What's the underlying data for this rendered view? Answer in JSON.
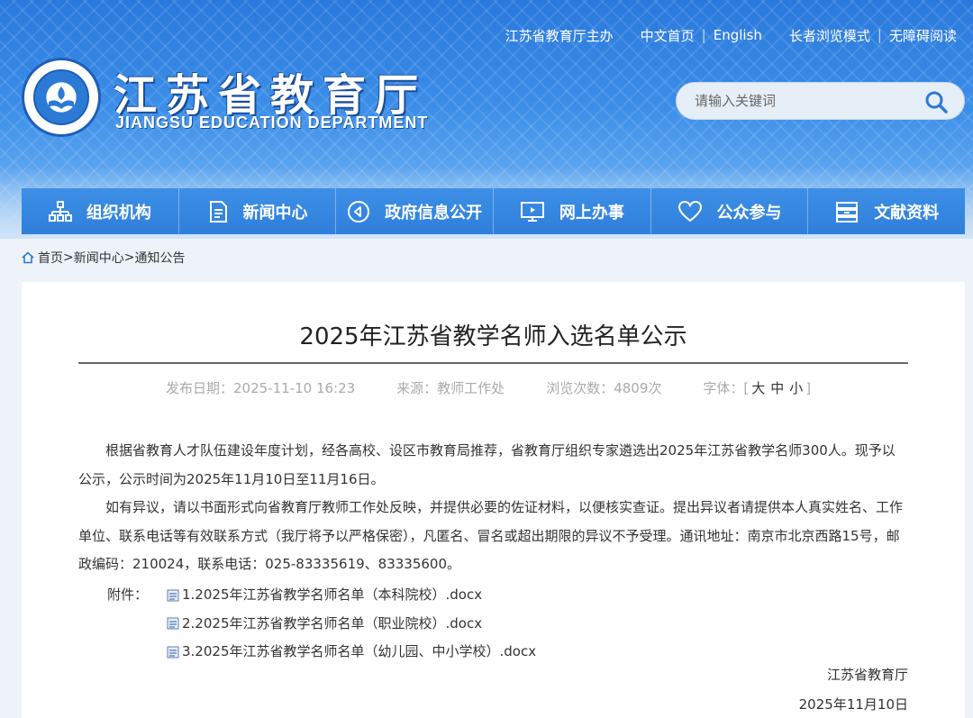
{
  "header": {
    "toplinks": {
      "host": "江苏省教育厅主办",
      "home_cn": "中文首页",
      "english": "English",
      "elder_mode": "长者浏览模式",
      "accessible": "无障碍阅读"
    },
    "logo_title": "江苏省教育厅",
    "logo_subtitle": "JIANGSU EDUCATION DEPARTMENT",
    "search": {
      "placeholder": "请输入关键词",
      "icon": "search-icon"
    }
  },
  "nav": [
    {
      "label": "组织机构",
      "icon": "org-chart-icon"
    },
    {
      "label": "新闻中心",
      "icon": "document-icon"
    },
    {
      "label": "政府信息公开",
      "icon": "speaker-icon"
    },
    {
      "label": "网上办事",
      "icon": "monitor-icon"
    },
    {
      "label": "公众参与",
      "icon": "heart-icon"
    },
    {
      "label": "文献资料",
      "icon": "archive-icon"
    }
  ],
  "breadcrumb": {
    "home": "首页",
    "sep": ">",
    "news": "新闻中心",
    "notice": "通知公告"
  },
  "article": {
    "title": "2025年江苏省教学名师入选名单公示",
    "meta": {
      "publish_date": "发布日期：2025-11-10 16:23",
      "source": "来源：教师工作处",
      "views": "浏览次数：4809次",
      "font_label": "字体：[",
      "font_large": "大",
      "font_medium": "中",
      "font_small": "小",
      "font_close": "]"
    },
    "paragraph1": "根据省教育人才队伍建设年度计划，经各高校、设区市教育局推荐，省教育厅组织专家遴选出2025年江苏省教学名师300人。现予以公示，公示时间为2025年11月10日至11月16日。",
    "paragraph2": "如有异议，请以书面形式向省教育厅教师工作处反映，并提供必要的佐证材料，以便核实查证。提出异议者请提供本人真实姓名、工作单位、联系电话等有效联系方式（我厅将予以严格保密），凡匿名、冒名或超出期限的异议不予受理。通讯地址：南京市北京西路15号，邮政编码：210024，联系电话：025-83335619、83335600。",
    "attachments_label": "附件：",
    "attachments": [
      "1.2025年江苏省教学名师名单（本科院校）.docx",
      "2.2025年江苏省教学名师名单（职业院校）.docx",
      "3.2025年江苏省教学名师名单（幼儿园、中小学校）.docx"
    ],
    "signature": "江苏省教育厅",
    "sign_date": "2025年11月10日"
  },
  "colors": {
    "header_blue": "#2e7fe0",
    "nav_blue": "#3a8be4",
    "text": "#333333"
  }
}
